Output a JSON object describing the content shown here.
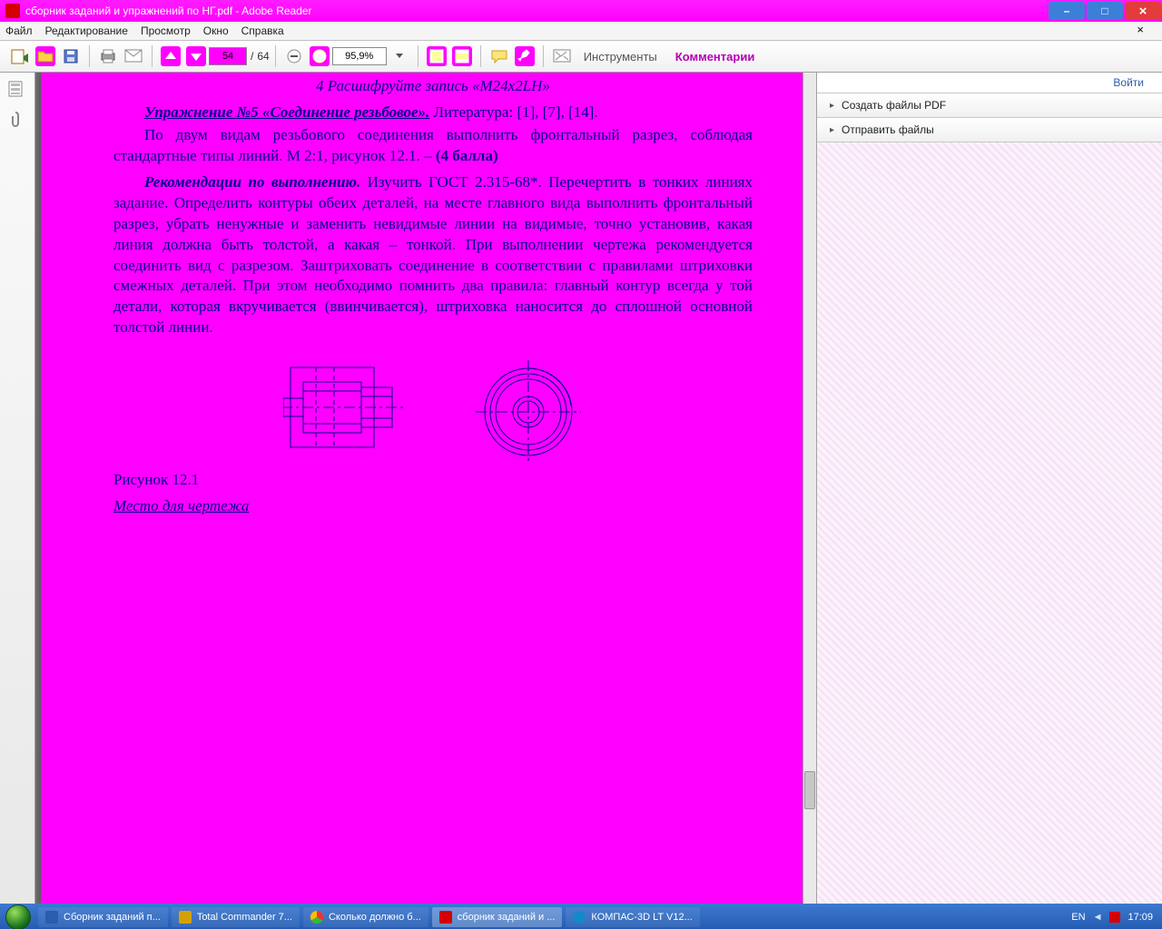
{
  "window": {
    "title": "сборник заданий и упражнений по НГ.pdf - Adobe Reader",
    "min": "–",
    "max": "□",
    "close": "×"
  },
  "menu": {
    "file": "Файл",
    "edit": "Редактирование",
    "view": "Просмотр",
    "window": "Окно",
    "help": "Справка",
    "x": "×"
  },
  "toolbar": {
    "page_current": "54",
    "page_sep": "/",
    "page_total": "64",
    "zoom": "95,9%",
    "tools": "Инструменты",
    "comments": "Комментарии"
  },
  "rightpanel": {
    "login": "Войти",
    "createpdf": "Создать файлы PDF",
    "sendfiles": "Отправить файлы"
  },
  "doc": {
    "line_cut": "4 Расшифруйте запись «M24x2LH»",
    "ex_title": "Упражнение №5 «Соединение резьбовое».",
    "ex_after": " Литература: [1], [7], [14].",
    "p1": "По двум видам резьбового соединения выполнить фронтальный разрез, соблюдая стандартные типы линий. М 2:1, рисунок 12.1. – ",
    "p1_bold": "(4 балла)",
    "rec_title": "Рекомендации по выполнению.",
    "p2": " Изучить ГОСТ 2.315-68*. Перечертить в тонких линиях задание. Определить контуры обеих деталей, на месте главного вида выполнить фронтальный разрез, убрать ненужные и заменить невидимые линии на видимые, точно установив, какая линия должна быть толстой, а какая – тонкой. При выполнении чертежа рекомендуется соединить  вид с  разрезом. Заштриховать соединение в соответствии с правилами штриховки смежных деталей. При этом необходимо помнить два правила: главный контур всегда у той детали, которая вкручивается (ввинчивается), штриховка наносится до сплошной основной толстой линии.",
    "fig_caption": "Рисунок 12.1",
    "place": "Место для чертежа"
  },
  "taskbar": {
    "t1": "Сборник заданий п...",
    "t2": "Total Commander 7...",
    "t3": "Сколько должно б...",
    "t4": "сборник заданий и ...",
    "t5": "КОМПАС-3D LT V12...",
    "lang": "EN",
    "time": "17:09"
  },
  "icons": {
    "app": "pdf-icon",
    "word": "word-icon",
    "tc": "totalcmd-icon",
    "chrome": "chrome-icon",
    "kompas": "kompas-icon"
  }
}
